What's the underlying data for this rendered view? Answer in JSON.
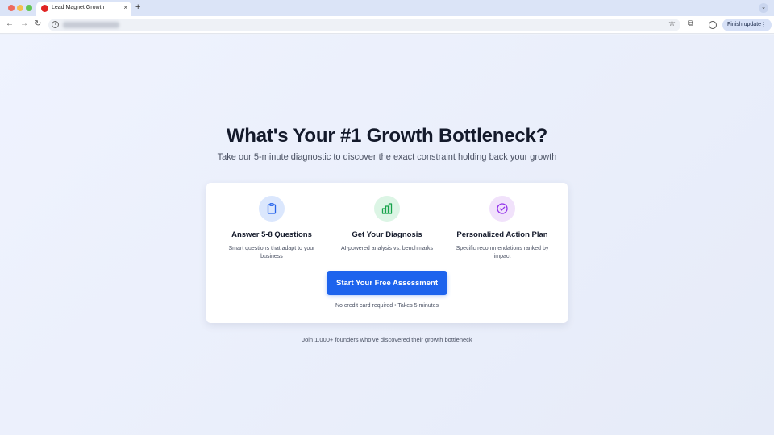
{
  "browser": {
    "tab_title": "Lead Magnet Growth",
    "tab_close": "×",
    "new_tab": "+",
    "tab_menu": "⌄",
    "back": "←",
    "forward": "→",
    "reload": "↻",
    "star": "☆",
    "extensions": "⧉",
    "finish_update": "Finish update",
    "finish_dots": "⋮"
  },
  "hero": {
    "headline": "What's Your #1 Growth Bottleneck?",
    "subhead": "Take our 5-minute diagnostic to discover the exact constraint holding back your growth"
  },
  "features": [
    {
      "icon": "clipboard-icon",
      "title": "Answer 5-8 Questions",
      "desc": "Smart questions that adapt to your business"
    },
    {
      "icon": "bar-chart-icon",
      "title": "Get Your Diagnosis",
      "desc": "AI-powered analysis vs. benchmarks"
    },
    {
      "icon": "check-circle-icon",
      "title": "Personalized Action Plan",
      "desc": "Specific recommendations ranked by impact"
    }
  ],
  "cta": {
    "label": "Start Your Free Assessment",
    "note": "No credit card required • Takes 5 minutes"
  },
  "social_proof": "Join 1,000+ founders who've discovered their growth bottleneck",
  "colors": {
    "accent": "#1d63ed",
    "icon_blue": "#dbe7fd",
    "icon_green": "#dcf5e5",
    "icon_purple": "#f1e2fb"
  }
}
